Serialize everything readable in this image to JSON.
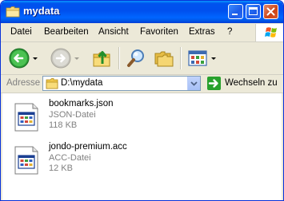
{
  "window": {
    "title": "mydata"
  },
  "menu": {
    "items": [
      "Datei",
      "Bearbeiten",
      "Ansicht",
      "Favoriten",
      "Extras",
      "?"
    ]
  },
  "toolbar": {
    "buttons": [
      "back-icon",
      "forward-icon",
      "folder-up-icon",
      "search-icon",
      "folders-icon",
      "views-icon"
    ]
  },
  "address": {
    "label": "Adresse",
    "path": "D:\\mydata",
    "go_label": "Wechseln zu"
  },
  "files": [
    {
      "name": "bookmarks.json",
      "type": "JSON-Datei",
      "size": "118 KB"
    },
    {
      "name": "jondo-premium.acc",
      "type": "ACC-Datei",
      "size": "12 KB"
    }
  ],
  "colors": {
    "titlebar": "#0054e3",
    "window_bg": "#ece9d8",
    "close_button": "#cc4416",
    "go_button": "#28a12d"
  }
}
